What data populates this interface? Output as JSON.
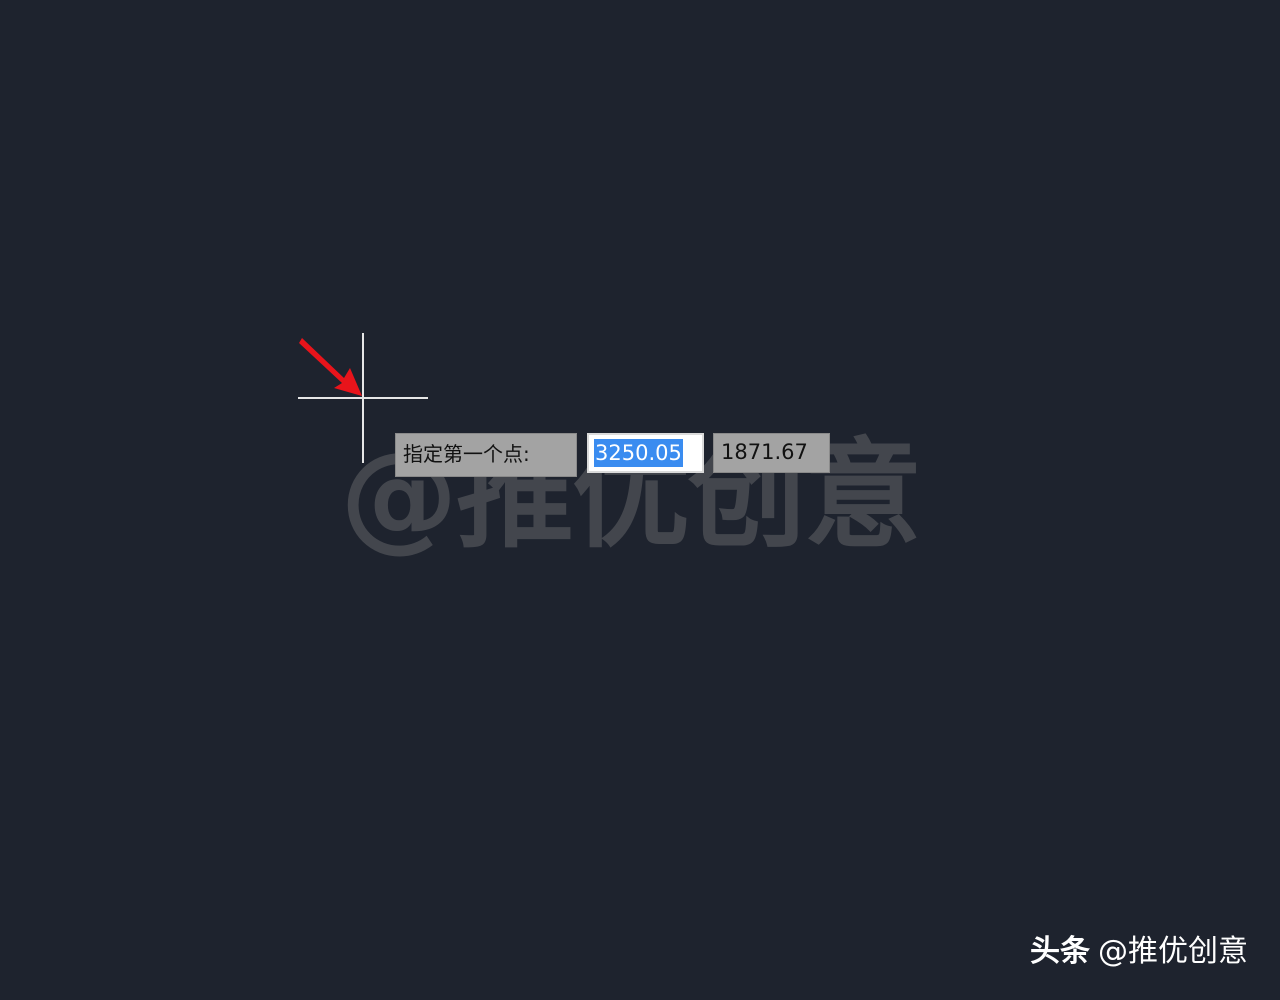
{
  "watermark": {
    "text": "@推优创意"
  },
  "cursor": {
    "crosshair_icon": "crosshair-icon",
    "arrow_icon": "red-arrow-icon",
    "arrow_color": "#e8141b"
  },
  "dynamic_input": {
    "prompt": "指定第一个点:",
    "x_value": "3250.05",
    "y_value": "1871.67",
    "selection_color": "#3a8cf0"
  },
  "credit": {
    "platform": "头条",
    "author": "@推优创意"
  }
}
